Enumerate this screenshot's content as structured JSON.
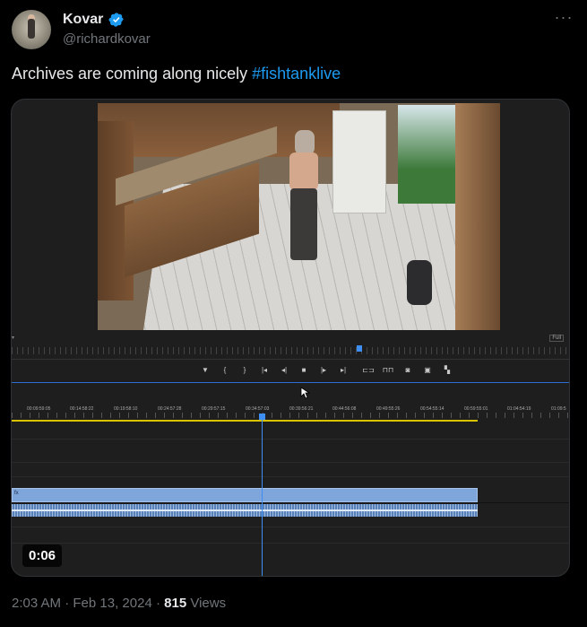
{
  "author": {
    "display_name": "Kovar",
    "handle": "@richardkovar"
  },
  "tweet": {
    "text": "Archives are coming along nicely ",
    "hashtag": "#fishtanklive"
  },
  "video": {
    "duration": "0:06",
    "scrub_right_label": "Full",
    "timecodes": [
      "00:09:59:05",
      "00:14:58:22",
      "00:19:58:10",
      "00:24:57:28",
      "00:29:57:15",
      "00:34:57:03",
      "00:39:56:21",
      "00:44:56:08",
      "00:49:55:26",
      "00:54:55:14",
      "00:59:55:01",
      "01:04:54:19",
      "01:09:5"
    ],
    "clip_label": "fx"
  },
  "meta": {
    "time": "2:03 AM",
    "separator": "·",
    "date": "Feb 13, 2024",
    "views_count": "815",
    "views_label": "Views"
  },
  "colors": {
    "accent": "#1d9bf0",
    "playhead": "#3d8ef0",
    "clip": "#7fa6db"
  }
}
